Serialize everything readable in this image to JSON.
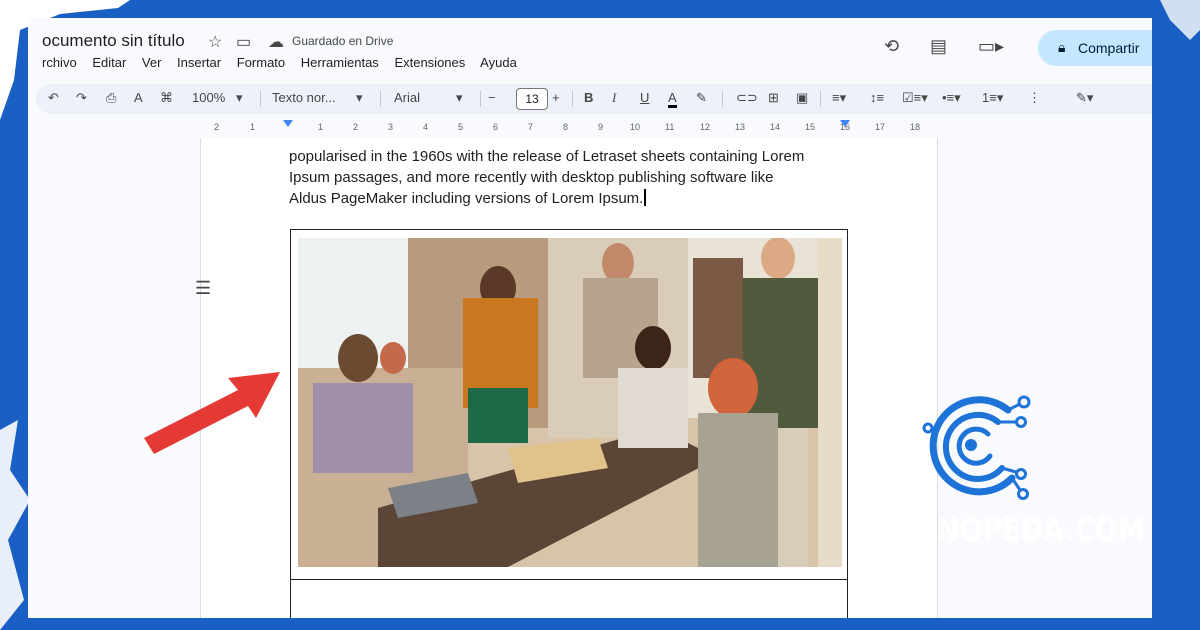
{
  "doc": {
    "title": "ocumento sin título",
    "saved_status": "Guardado en Drive",
    "share_label": "Compartir"
  },
  "menu": [
    "rchivo",
    "Editar",
    "Ver",
    "Insertar",
    "Formato",
    "Herramientas",
    "Extensiones",
    "Ayuda"
  ],
  "toolbar": {
    "zoom": "100%",
    "style": "Texto nor...",
    "font": "Arial",
    "font_size": "13",
    "minus": "−",
    "plus": "+"
  },
  "ruler": {
    "numbers": [
      "2",
      "1",
      "1",
      "2",
      "3",
      "4",
      "5",
      "6",
      "7",
      "8",
      "9",
      "10",
      "11",
      "12",
      "13",
      "14",
      "15",
      "16",
      "17",
      "18"
    ]
  },
  "content": {
    "line1": "popularised in the 1960s with the release of Letraset sheets containing Lorem",
    "line2": "Ipsum passages, and more recently with desktop publishing software like",
    "line3": "Aldus PageMaker including versions of Lorem Ipsum."
  },
  "brand": {
    "name": "TECNOPEDA.COM"
  },
  "icons": {
    "star": "star-icon",
    "move": "folder-move-icon",
    "cloud": "cloud-saved-icon",
    "history": "history-icon",
    "comment": "comment-icon",
    "meet": "video-call-icon",
    "lock": "lock-icon",
    "outline": "document-outline-icon",
    "pencil": "editing-mode-icon"
  },
  "colors": {
    "frame": "#1a5fc4",
    "arrow": "#e53935",
    "share": "#c2e7ff",
    "toolbar": "#edf2fa"
  }
}
